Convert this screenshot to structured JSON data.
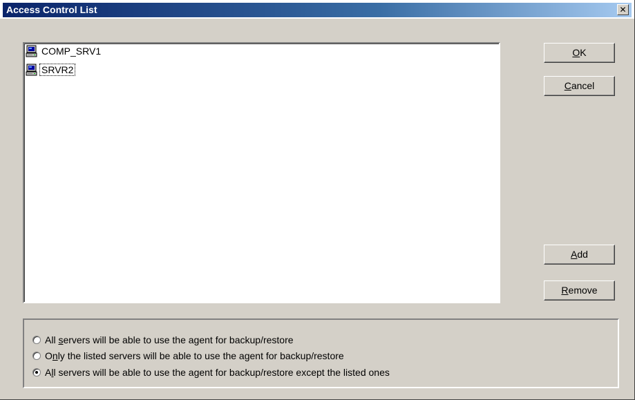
{
  "window": {
    "title": "Access Control List",
    "close_glyph": "✕"
  },
  "list": {
    "items": [
      {
        "label": "COMP_SRV1",
        "icon": "server-icon",
        "focused": false
      },
      {
        "label": "SRVR2",
        "icon": "server-icon",
        "focused": true
      }
    ]
  },
  "buttons": {
    "ok": {
      "mnemonic": "O",
      "rest": "K"
    },
    "cancel": {
      "mnemonic": "C",
      "rest": "ancel"
    },
    "add": {
      "mnemonic": "A",
      "rest": "dd"
    },
    "remove": {
      "mnemonic": "R",
      "rest": "emove"
    }
  },
  "options": [
    {
      "before": "All ",
      "mnemonic": "s",
      "after": "ervers will be able to use the agent for backup/restore",
      "checked": false
    },
    {
      "before": "O",
      "mnemonic": "n",
      "after": "ly the listed servers will be able to use the agent for backup/restore",
      "checked": false
    },
    {
      "before": "A",
      "mnemonic": "l",
      "after": "l servers will be able to use the agent for backup/restore except the listed ones",
      "checked": true
    }
  ],
  "colors": {
    "dialog_face": "#d4d0c8",
    "title_gradient_start": "#0a246a",
    "title_gradient_end": "#a6caf0"
  }
}
